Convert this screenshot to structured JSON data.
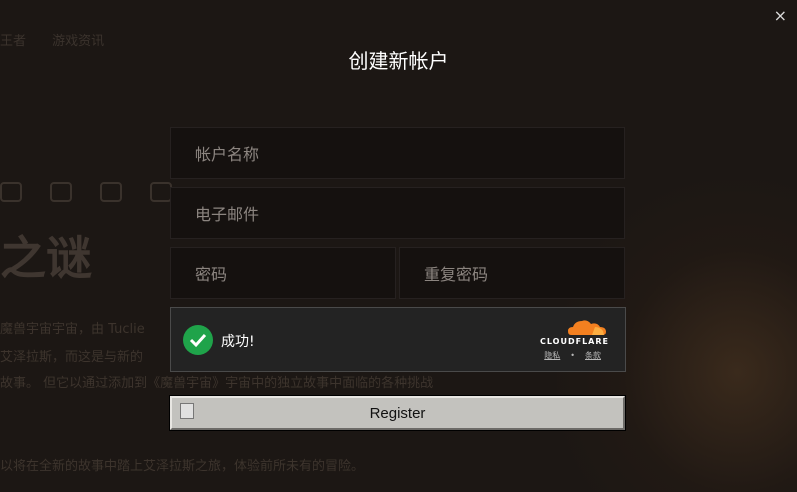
{
  "modal": {
    "title": "创建新帐户",
    "close_symbol": "×",
    "fields": {
      "account_name_placeholder": "帐户名称",
      "email_placeholder": "电子邮件",
      "password_placeholder": "密码",
      "repeat_password_placeholder": "重复密码"
    },
    "captcha": {
      "status": "成功!",
      "brand": "CLOUDFLARE",
      "privacy_link": "隐私",
      "separator": "•",
      "terms_link": "条款",
      "status_color": "#1fa34a"
    },
    "register_label": "Register"
  },
  "background": {
    "nav_items": [
      "王者",
      "游戏资讯"
    ],
    "headline": "之谜",
    "paragraphs": [
      "魔兽宇宙宇宙，由 Tuclie",
      "艾泽拉斯，而这是与新的",
      "故事。 但它以通过添加到《魔兽宇宙》宇宙中的独立故事中面临的各种挑战",
      "以将在全新的故事中踏上艾泽拉斯之旅，体验前所未有的冒险。"
    ]
  },
  "colors": {
    "accent_orange": "#f38020",
    "modal_text": "#ffffff"
  }
}
